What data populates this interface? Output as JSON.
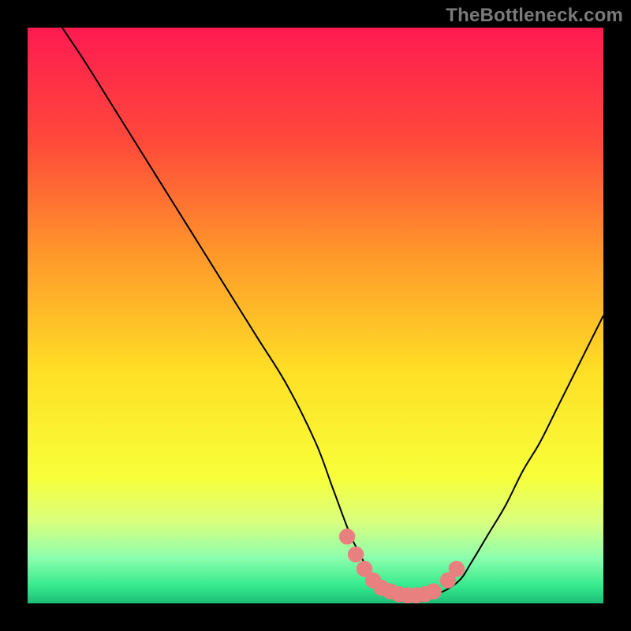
{
  "watermark": "TheBottleneck.com",
  "chart_data": {
    "type": "line",
    "title": "",
    "xlabel": "",
    "ylabel": "",
    "xlim": [
      0,
      100
    ],
    "ylim": [
      0,
      100
    ],
    "grid": false,
    "legend": false,
    "background_gradient": {
      "stops": [
        {
          "offset": 0.0,
          "color": "#ff1a51"
        },
        {
          "offset": 0.2,
          "color": "#ff4a3a"
        },
        {
          "offset": 0.4,
          "color": "#ff9a2a"
        },
        {
          "offset": 0.6,
          "color": "#ffe026"
        },
        {
          "offset": 0.78,
          "color": "#f8ff3a"
        },
        {
          "offset": 0.86,
          "color": "#d8ff80"
        },
        {
          "offset": 0.92,
          "color": "#8dffad"
        },
        {
          "offset": 0.97,
          "color": "#35e98d"
        },
        {
          "offset": 1.0,
          "color": "#1dbd78"
        }
      ]
    },
    "series": [
      {
        "name": "curve",
        "stroke": "#000000",
        "stroke_width": 2,
        "x": [
          6,
          10,
          15,
          20,
          25,
          30,
          35,
          40,
          45,
          50,
          53,
          56,
          58,
          60,
          63,
          66,
          69,
          72,
          75,
          77,
          80,
          83,
          86,
          89,
          92,
          95,
          98,
          100
        ],
        "y": [
          100,
          94,
          86,
          78,
          70,
          62,
          54,
          46,
          38,
          28,
          20,
          12,
          8,
          4,
          2,
          1.3,
          1.3,
          2,
          4,
          7,
          12,
          17,
          23,
          28,
          34,
          40,
          46,
          50
        ]
      },
      {
        "name": "optimal-zone-dots",
        "type": "scatter",
        "stroke": "#e98080",
        "fill": "#e98080",
        "radius_pct": 1.4,
        "x": [
          55.5,
          57,
          58.5,
          60,
          61.5,
          63,
          64.5,
          66,
          67.5,
          69,
          70.5,
          73,
          74.5
        ],
        "y": [
          11.6,
          8.5,
          6,
          4,
          2.7,
          2.1,
          1.6,
          1.4,
          1.4,
          1.6,
          2.1,
          4,
          6
        ]
      }
    ]
  }
}
